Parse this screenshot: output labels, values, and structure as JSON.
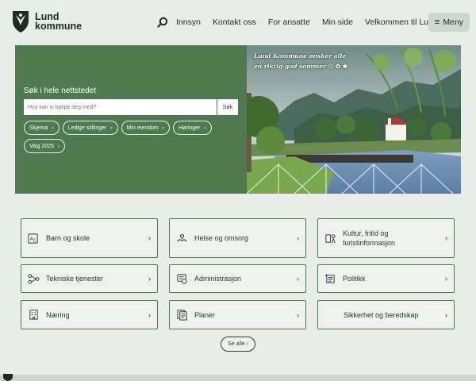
{
  "brand": {
    "line1": "Lund",
    "line2": "kommune"
  },
  "nav": {
    "items": [
      "Innsyn",
      "Kontakt oss",
      "For ansatte",
      "Min side",
      "Velkommen til Lund"
    ],
    "menu_label": "Meny"
  },
  "search": {
    "title": "Søk i hele nettstedet",
    "placeholder": "Hva kan vi hjelpe deg med?",
    "button_label": "Søk"
  },
  "quick_links": [
    "Skjema",
    "Ledige stillinger",
    "Min eiendom",
    "Høringer",
    "Valg 2025"
  ],
  "banner": {
    "line1": "Lund Kommune ønsker alle",
    "line2": "en riktig god sommer"
  },
  "services": [
    {
      "label": "Barn og skole",
      "icon": "abc-icon"
    },
    {
      "label": "Helse og omsorg",
      "icon": "care-hands-icon"
    },
    {
      "label": "Kultur, fritid og turistinformasjon",
      "icon": "culture-icon"
    },
    {
      "label": "Tekniske tjenester",
      "icon": "network-icon"
    },
    {
      "label": "Administrasjon",
      "icon": "admin-icon"
    },
    {
      "label": "Politikk",
      "icon": "politics-icon"
    },
    {
      "label": "Næring",
      "icon": "building-icon"
    },
    {
      "label": "Planer",
      "icon": "plans-icon"
    },
    {
      "label": "Sikkerhet og beredskap",
      "icon": ""
    }
  ],
  "see_all": "Se alle ›",
  "colors": {
    "primary_green": "#4f7a50",
    "background": "#e9ede9",
    "text": "#2d3a30"
  }
}
